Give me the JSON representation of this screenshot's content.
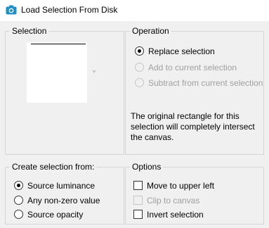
{
  "window": {
    "title": "Load Selection From Disk",
    "icon": "camera-app-icon",
    "accent_color": "#1e90c8"
  },
  "selection_group": {
    "label": "Selection"
  },
  "operation_group": {
    "label": "Operation",
    "options": [
      {
        "label": "Replace selection",
        "checked": true,
        "enabled": true
      },
      {
        "label": "Add to current selection",
        "checked": false,
        "enabled": false
      },
      {
        "label": "Subtract from current selection",
        "checked": false,
        "enabled": false
      }
    ],
    "info_text": "The original rectangle for this selection will completely intersect the canvas."
  },
  "create_group": {
    "label": "Create selection from:",
    "options": [
      {
        "label": "Source luminance",
        "checked": true
      },
      {
        "label": "Any non-zero value",
        "checked": false
      },
      {
        "label": "Source opacity",
        "checked": false
      }
    ]
  },
  "options_group": {
    "label": "Options",
    "checkboxes": [
      {
        "label": "Move to upper left",
        "checked": false,
        "enabled": true
      },
      {
        "label": "Clip to canvas",
        "checked": false,
        "enabled": false
      },
      {
        "label": "Invert selection",
        "checked": false,
        "enabled": true
      }
    ]
  }
}
